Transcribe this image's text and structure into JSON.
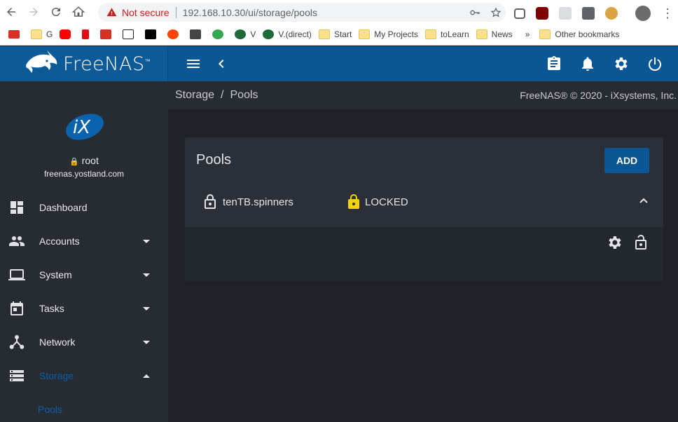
{
  "browser": {
    "security_label": "Not secure",
    "url": "192.168.10.30/ui/storage/pools",
    "bookmarks": [
      {
        "label": "G"
      },
      {
        "label": "V"
      },
      {
        "label": "V.(direct)"
      },
      {
        "label": "Start"
      },
      {
        "label": "My Projects"
      },
      {
        "label": "toLearn"
      },
      {
        "label": "News"
      }
    ],
    "more_label": "»",
    "other_bookmarks": "Other bookmarks"
  },
  "app": {
    "logo_text": "FreeNAS",
    "logo_tm": "™",
    "brand_color": "#0b5796"
  },
  "sidebar": {
    "user": "root",
    "hostname": "freenas.yostland.com",
    "items": [
      {
        "label": "Dashboard",
        "icon": "dashboard-icon"
      },
      {
        "label": "Accounts",
        "icon": "people-icon"
      },
      {
        "label": "System",
        "icon": "laptop-icon"
      },
      {
        "label": "Tasks",
        "icon": "calendar-icon"
      },
      {
        "label": "Network",
        "icon": "network-icon"
      },
      {
        "label": "Storage",
        "icon": "storage-icon"
      }
    ],
    "sub_item": "Pools"
  },
  "breadcrumb": {
    "parent": "Storage",
    "separator": "/",
    "current": "Pools"
  },
  "copyright": "FreeNAS® © 2020 - iXsystems, Inc.",
  "pools_card": {
    "title": "Pools",
    "add_label": "ADD",
    "pools": [
      {
        "name": "tenTB.spinners",
        "status": "LOCKED"
      }
    ]
  }
}
